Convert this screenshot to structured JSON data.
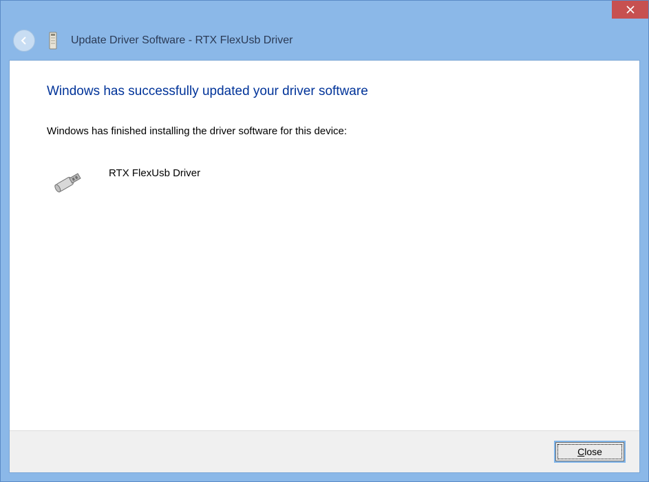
{
  "window": {
    "title": "Update Driver Software - RTX FlexUsb Driver"
  },
  "main": {
    "headline": "Windows has successfully updated your driver software",
    "subline": "Windows has finished installing the driver software for this device:",
    "device_name": "RTX FlexUsb Driver"
  },
  "footer": {
    "close_label": "Close",
    "close_accel_char": "C",
    "close_rest": "lose"
  }
}
